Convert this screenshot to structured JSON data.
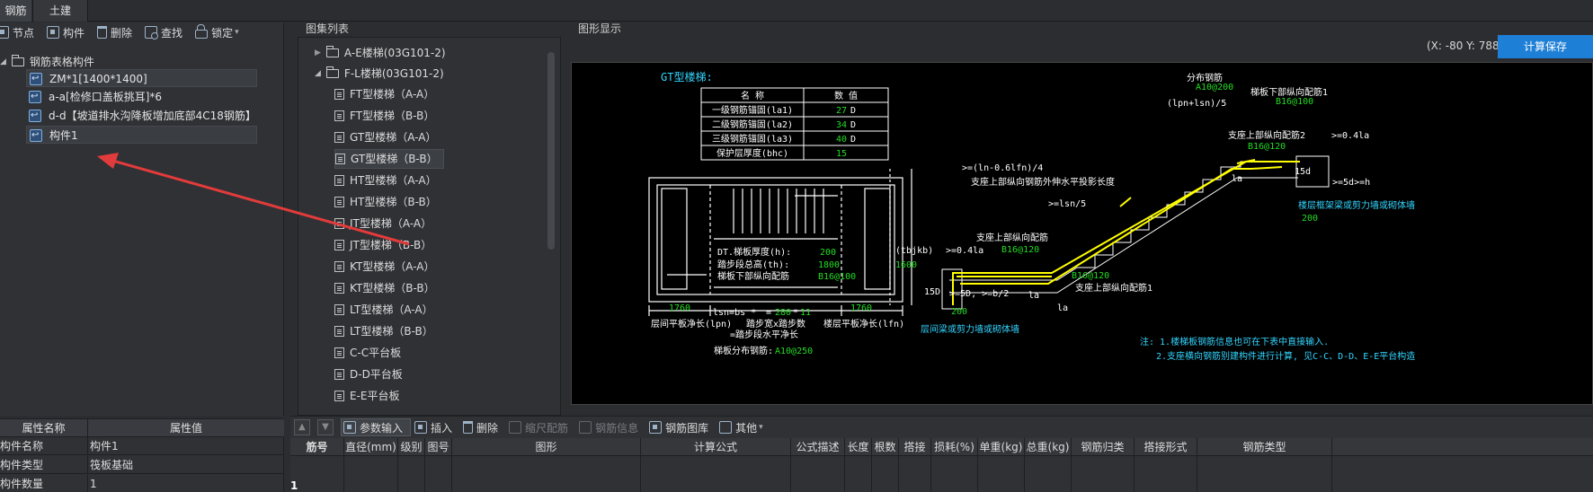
{
  "tabs": [
    {
      "label": "钢筋",
      "active": true
    },
    {
      "label": "土建",
      "active": false
    }
  ],
  "left_toolbar": [
    {
      "label": "节点",
      "icon": "node-icon"
    },
    {
      "label": "构件",
      "icon": "component-icon"
    },
    {
      "label": "删除",
      "icon": "trash-icon"
    },
    {
      "label": "查找",
      "icon": "find-icon"
    },
    {
      "label": "锁定",
      "icon": "lock-icon"
    }
  ],
  "tree": {
    "root": "钢筋表格构件",
    "items": [
      "ZM*1[1400*1400]",
      "a-a[检修口盖板挑耳]*6",
      "d-d【坡道排水沟降板增加底部4C18钢筋】",
      "构件1"
    ]
  },
  "properties": {
    "headers": [
      "属性名称",
      "属性值"
    ],
    "rows": [
      {
        "name": "构件名称",
        "value": "构件1"
      },
      {
        "name": "构件类型",
        "value": "筏板基础"
      },
      {
        "name": "构件数量",
        "value": "1"
      }
    ]
  },
  "atlas": {
    "title": "图集列表",
    "groups": [
      {
        "label": "A-E楼梯(03G101-2)",
        "expanded": false
      },
      {
        "label": "F-L楼梯(03G101-2)",
        "expanded": true
      }
    ],
    "items": [
      "FT型楼梯（A-A）",
      "FT型楼梯（B-B）",
      "GT型楼梯（A-A）",
      "GT型楼梯（B-B）",
      "HT型楼梯（A-A）",
      "HT型楼梯（B-B）",
      "JT型楼梯（A-A）",
      "JT型楼梯（B-B）",
      "KT型楼梯（A-A）",
      "KT型楼梯（B-B）",
      "LT型楼梯（A-A）",
      "LT型楼梯（B-B）",
      "C-C平台板",
      "D-D平台板",
      "E-E平台板"
    ],
    "selected_index": 3
  },
  "graphics": {
    "title": "图形显示",
    "coords": "(X: -80 Y: 788)",
    "calc_save": "计算保存",
    "drawing": {
      "heading": "GT型楼梯:",
      "table_headers": [
        "名 称",
        "数 值"
      ],
      "table_rows": [
        {
          "name": "一级钢筋锚固(la1)",
          "value": "27",
          "unit": "D"
        },
        {
          "name": "二级钢筋锚固(la2)",
          "value": "34",
          "unit": "D"
        },
        {
          "name": "三级钢筋锚固(la3)",
          "value": "40",
          "unit": "D"
        },
        {
          "name": "保护层厚度(bhc)",
          "value": "15",
          "unit": ""
        }
      ],
      "dt_label": "DT.梯板厚度(h):",
      "dt_value": "200",
      "th_label": "踏步段总高(th):",
      "th_value": "1800",
      "bottom_rebar_label": "梯板下部纵向配筋",
      "bottom_rebar_value": "B16@100",
      "left_1760": "1760",
      "right_1760": "1760",
      "lsn_label": "lsn=bs *",
      "lsn_bs": "280",
      "lsn_count": "11",
      "mid_label1": "层间平板净长(lpn)",
      "mid_label2": "踏步宽x踏步数",
      "mid_label3": "=踏步段水平净长",
      "right_plat_label": "楼层平板净长(lfn)",
      "dist_rebar_label": "梯板分布钢筋:",
      "dist_rebar_value": "A10@250",
      "ann_top_dist": "分布钢筋",
      "ann_top_dist_val": "A10@200",
      "ann_top_formula": "(lpn+lsn)/5",
      "ann_bottom_rebar1": "梯板下部纵向配筋1",
      "ann_bottom_rebar1_val": "B16@100",
      "ann_support_top2": "支座上部纵向配筋2",
      "ann_support_top2_val": "B16@120",
      "ann_04la_right": ">=0.4la",
      "ann_15d_right": "15d",
      "ann_5d_h": ">=5d>=h",
      "ann_floor_beam": "楼层框架梁或剪力墙或砌体墙",
      "ann_200_right": "200",
      "ann_la_right": "la",
      "ann_ln_formula": ">=(ln-0.6lfn)/4",
      "ann_support_ext": "支座上部纵向钢筋外伸水平投影长度",
      "ann_lsn5": ">=lsn/5",
      "ann_tbjkb": "(tbjkb)",
      "ann_1600": "1600",
      "ann_04la_left": ">=0.4la",
      "ann_support_top_left": "支座上部纵向配筋",
      "ann_support_top_left_val": "B16@120",
      "ann_15d_left": "15D",
      "ann_5d_b2": ">=5D, >=b/2",
      "ann_200_left": "200",
      "ann_mid_beam": "层间梁或剪力墙或砌体墙",
      "ann_b16120_mid": "B16@120",
      "ann_support_top1": "支座上部纵向配筋1",
      "ann_la_left": "la",
      "ann_la_mid": "la",
      "note1": "注: 1.楼梯板钢筋信息也可在下表中直接输入.",
      "note2": "2.支座横向钢筋别建构件进行计算, 见C-C、D-D、E-E平台构造"
    }
  },
  "grid_toolbar": [
    {
      "label": "参数输入",
      "state": "active"
    },
    {
      "label": "插入",
      "state": "normal"
    },
    {
      "label": "删除",
      "state": "normal"
    },
    {
      "label": "缩尺配筋",
      "state": "disabled"
    },
    {
      "label": "钢筋信息",
      "state": "disabled"
    },
    {
      "label": "钢筋图库",
      "state": "normal"
    },
    {
      "label": "其他",
      "state": "normal"
    }
  ],
  "grid_columns": [
    "筋号",
    "直径(mm)",
    "级别",
    "图号",
    "图形",
    "计算公式",
    "公式描述",
    "长度",
    "根数",
    "搭接",
    "损耗(%)",
    "单重(kg)",
    "总重(kg)",
    "钢筋归类",
    "搭接形式",
    "钢筋类型"
  ],
  "grid_rows": [
    {
      "index": "1"
    }
  ],
  "colors": {
    "accent_button": "#1e7fd6",
    "drawing_white": "#ffffff",
    "drawing_green": "#22dd22",
    "drawing_yellow": "#ffff00",
    "drawing_cyan": "#33d6ff",
    "annotation_arrow": "#e23b3b"
  }
}
